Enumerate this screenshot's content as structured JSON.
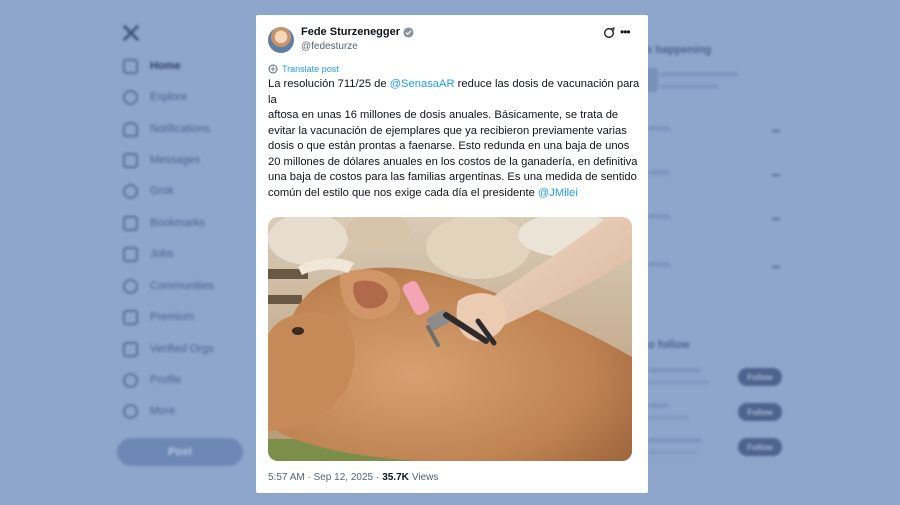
{
  "sidebar": {
    "items": [
      {
        "label": "Home",
        "icon": "home-icon"
      },
      {
        "label": "Explore",
        "icon": "search-icon"
      },
      {
        "label": "Notifications",
        "icon": "bell-icon"
      },
      {
        "label": "Messages",
        "icon": "mail-icon"
      },
      {
        "label": "Grok",
        "icon": "grok-icon"
      },
      {
        "label": "Bookmarks",
        "icon": "bookmark-icon"
      },
      {
        "label": "Jobs",
        "icon": "briefcase-icon"
      },
      {
        "label": "Communities",
        "icon": "people-icon"
      },
      {
        "label": "Premium",
        "icon": "x-icon"
      },
      {
        "label": "Verified Orgs",
        "icon": "lightning-icon"
      },
      {
        "label": "Profile",
        "icon": "person-icon"
      },
      {
        "label": "More",
        "icon": "more-circle-icon"
      }
    ],
    "post_label": "Post"
  },
  "right_panel": {
    "happening_title": "t's happening",
    "follow_title": "o follow",
    "follow_label": "Follow"
  },
  "tweet": {
    "author_name": "Fede Sturzenegger",
    "author_handle": "@fedesturze",
    "translate_label": "Translate post",
    "text_part1": "La resolución 711/25 de ",
    "mention1": "@SenasaAR",
    "text_part2": " reduce las dosis de vacunación para la",
    "text_part3": "aftosa en unas 16 millones de dosis anuales. Básicamente, se trata de evitar la vacunación de ejemplares que ya recibieron previamente varias dosis o que están prontas a faenarse. Esto redunda en una baja de unos 20 millones de dólares anuales en los costos de la ganadería, en definitiva una baja de costos para las familias argentinas. Es una medida de sentido común del estilo que nos exige cada día el presidente ",
    "mention2": "@JMilei",
    "time": "5:57 AM · Sep 12, 2025 · ",
    "views_count": "35.7K",
    "views_label": "Views"
  },
  "colors": {
    "background": "#8ea5cc",
    "card": "#ffffff",
    "link": "#1d9bf0",
    "text": "#0f1419",
    "muted": "#536471"
  }
}
